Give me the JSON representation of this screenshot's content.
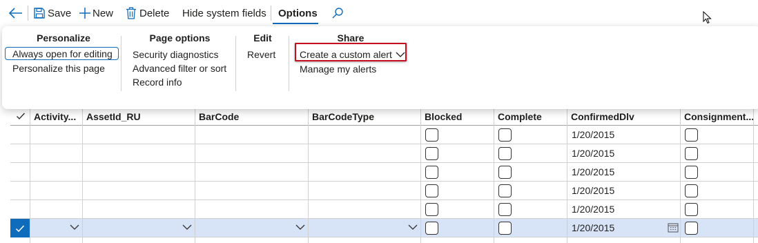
{
  "toolbar": {
    "save_label": "Save",
    "new_label": "New",
    "delete_label": "Delete",
    "hide_system_fields_label": "Hide system fields",
    "options_label": "Options"
  },
  "options_flyout": {
    "personalize": {
      "title": "Personalize",
      "items": [
        "Always open for editing",
        "Personalize this page"
      ]
    },
    "page_options": {
      "title": "Page options",
      "items": [
        "Security diagnostics",
        "Advanced filter or sort",
        "Record info"
      ]
    },
    "edit": {
      "title": "Edit",
      "items": [
        "Revert"
      ]
    },
    "share": {
      "title": "Share",
      "items": [
        "Create a custom alert",
        "Manage my alerts"
      ]
    }
  },
  "grid": {
    "columns": [
      "Activity...",
      "AssetId_RU",
      "BarCode",
      "BarCodeType",
      "Blocked",
      "Complete",
      "ConfirmedDlv",
      "Consignment..."
    ],
    "rows": [
      {
        "confirmed_dlv": "1/20/2015",
        "selected": false
      },
      {
        "confirmed_dlv": "1/20/2015",
        "selected": false
      },
      {
        "confirmed_dlv": "1/20/2015",
        "selected": false
      },
      {
        "confirmed_dlv": "1/20/2015",
        "selected": false
      },
      {
        "confirmed_dlv": "1/20/2015",
        "selected": false
      },
      {
        "confirmed_dlv": "1/20/2015",
        "selected": true
      }
    ]
  },
  "colors": {
    "accent": "#0f6cbd",
    "highlight_border": "#c50f1f",
    "selected_row": "#d7e3f7"
  }
}
